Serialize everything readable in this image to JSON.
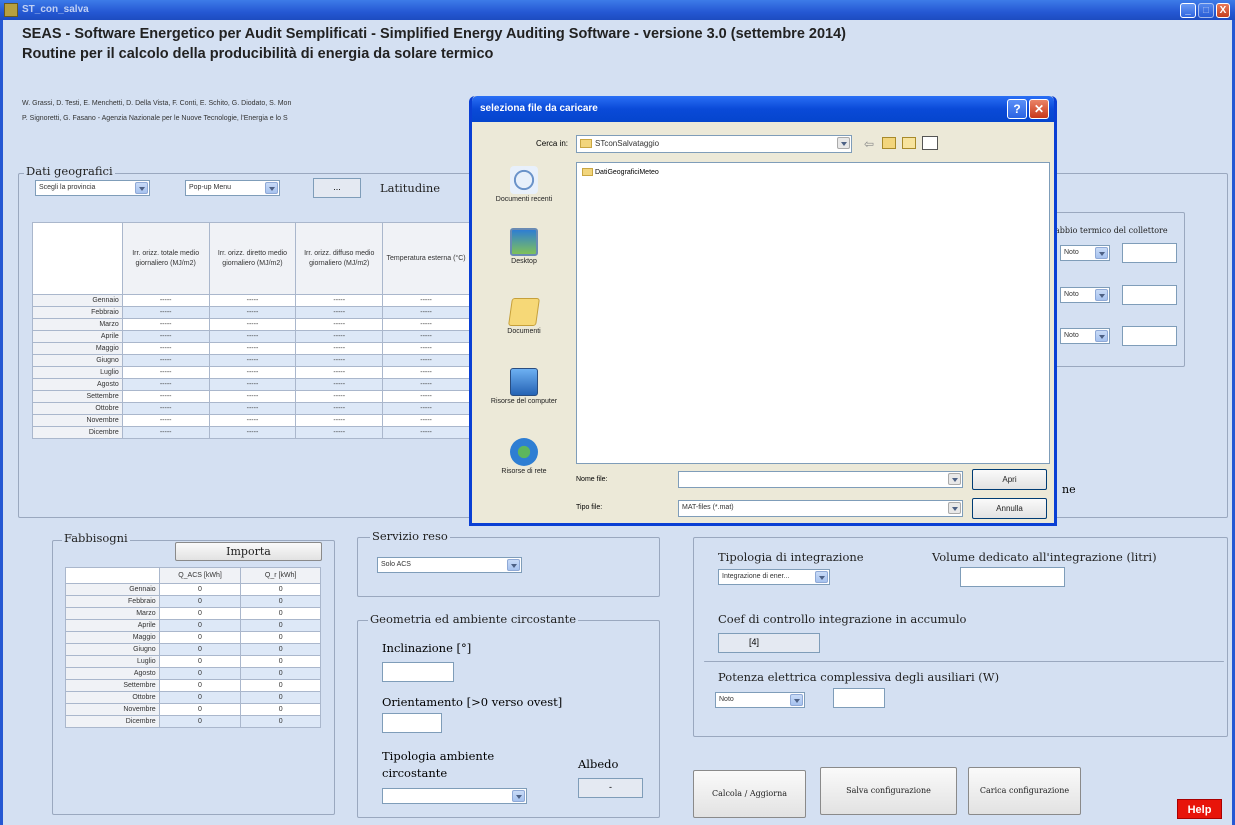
{
  "window": {
    "title": "ST_con_salva",
    "controls": [
      "_",
      "□",
      "X"
    ]
  },
  "header": {
    "line1": "SEAS - Software Energetico per Audit Semplificati - Simplified Energy Auditing Software - versione 3.0 (settembre 2014)",
    "line2": "Routine per il calcolo della producibilità di energia da solare termico",
    "authors1": "W. Grassi, D. Testi, E. Menchetti, D. Della Vista, F. Conti, E. Schito, G. Diodato, S. Mon",
    "authors2": "P. Signoretti, G. Fasano - Agenzia Nazionale per le Nuove Tecnologie, l'Energia e lo S"
  },
  "dati_geografici": {
    "title": "Dati geografici",
    "provincia_dd": "Scegli la provincia",
    "popup_dd": "Pop-up Menu",
    "value_box": "...",
    "latitudine_label": "Latitudine",
    "headers": [
      "Irr. orizz. totale medio giornaliero (MJ/m2)",
      "Irr. orizz. diretto medio giornaliero (MJ/m2)",
      "Irr. orizz. diffuso medio giornaliero (MJ/m2)",
      "Temperatura esterna (°C)"
    ],
    "months": [
      "Gennaio",
      "Febbraio",
      "Marzo",
      "Aprile",
      "Maggio",
      "Giugno",
      "Luglio",
      "Agosto",
      "Settembre",
      "Ottobre",
      "Novembre",
      "Dicembre"
    ],
    "placeholder": "-----"
  },
  "collettore": {
    "label": "abbio termico del collettore",
    "dd_text": "Noto"
  },
  "fabbisogni": {
    "title": "Fabbisogni",
    "importa": "Importa",
    "headers": [
      "Q_ACS [kWh]",
      "Q_r [kWh]"
    ],
    "rows": [
      [
        "Gennaio",
        "0",
        "0"
      ],
      [
        "Febbraio",
        "0",
        "0"
      ],
      [
        "Marzo",
        "0",
        "0"
      ],
      [
        "Aprile",
        "0",
        "0"
      ],
      [
        "Maggio",
        "0",
        "0"
      ],
      [
        "Giugno",
        "0",
        "0"
      ],
      [
        "Luglio",
        "0",
        "0"
      ],
      [
        "Agosto",
        "0",
        "0"
      ],
      [
        "Settembre",
        "0",
        "0"
      ],
      [
        "Ottobre",
        "0",
        "0"
      ],
      [
        "Novembre",
        "0",
        "0"
      ],
      [
        "Dicembre",
        "0",
        "0"
      ]
    ]
  },
  "servizio": {
    "title": "Servizio reso",
    "dd": "Solo ACS"
  },
  "geometria": {
    "title": "Geometria ed ambiente circostante",
    "inclinazione": "Inclinazione [°]",
    "orientamento": "Orientamento [>0 verso ovest]",
    "tipologia": "Tipologia ambiente circostante",
    "albedo": "Albedo",
    "albedo_value": "-"
  },
  "integrazione": {
    "tipologia_label": "Tipologia di integrazione",
    "tipologia_dd": "Integrazione di ener...",
    "volume_label": "Volume dedicato all'integrazione (litri)",
    "coef_label": "Coef di controllo integrazione in accumulo",
    "coef_value": "[4]",
    "potenza_label": "Potenza elettrica complessiva degli ausiliari (W)",
    "potenza_dd": "Noto",
    "other_text": "ne"
  },
  "buttons": {
    "calcola": "Calcola / Aggiorna",
    "salva": "Salva configurazione",
    "carica": "Carica configurazione",
    "help": "Help"
  },
  "dialog": {
    "title": "seleziona file da caricare",
    "cerca_in_label": "Cerca in:",
    "cerca_in_value": "STconSalvataggio",
    "places": [
      "Documenti recenti",
      "Desktop",
      "Documenti",
      "Risorse del computer",
      "Risorse di rete"
    ],
    "files": [
      "DatiGeograficiMeteo"
    ],
    "nome_file_label": "Nome file:",
    "nome_file_value": "",
    "tipo_file_label": "Tipo file:",
    "tipo_file_value": "MAT-files (*.mat)",
    "apri": "Apri",
    "annulla": "Annulla"
  },
  "colors": {
    "titlebar": "#2558d3",
    "background": "#d4e0f2",
    "help": "#e8140a"
  }
}
